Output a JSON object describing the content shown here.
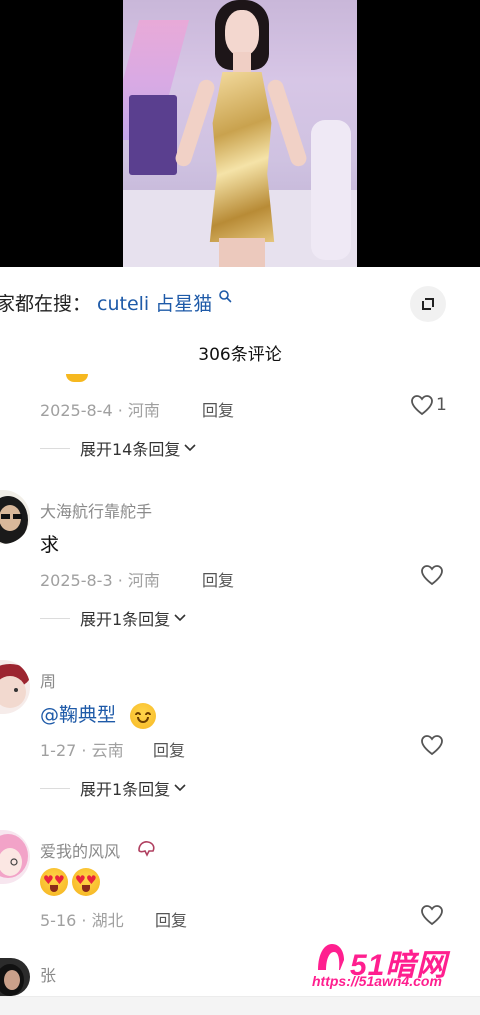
{
  "video": {
    "alt": ""
  },
  "search_suggestion": {
    "prefix": "家都在搜：",
    "term": "cuteli 占星猫"
  },
  "comments_header": {
    "count_label": "306条评论"
  },
  "comments": [
    {
      "meta": "2025-8-4 · 河南",
      "reply_label": "回复",
      "like_count": "1",
      "expand_label": "展开14条回复"
    },
    {
      "author": "大海航行靠舵手",
      "content": "求",
      "meta": "2025-8-3 · 河南",
      "reply_label": "回复",
      "expand_label": "展开1条回复"
    },
    {
      "author": "周",
      "mention": "@鞠典型",
      "meta": "1-27 · 云南",
      "reply_label": "回复",
      "expand_label": "展开1条回复"
    },
    {
      "author": "爱我的风风",
      "meta": "5-16 · 湖北",
      "reply_label": "回复"
    },
    {
      "author": "张"
    }
  ],
  "watermark": {
    "logo_text": "51暗网",
    "url": "https://51awn4.com"
  },
  "colors": {
    "link": "#1e5aa8",
    "watermark": "#ff1f8f",
    "muted": "#a0a0a0"
  }
}
